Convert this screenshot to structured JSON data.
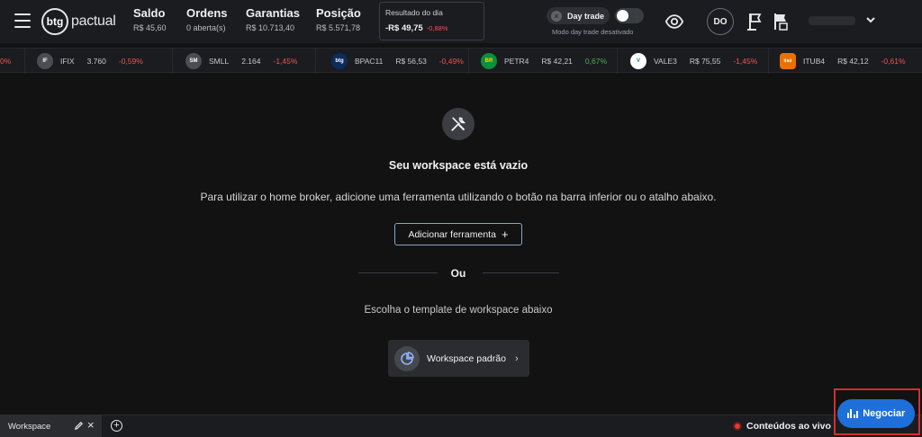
{
  "header": {
    "logo_mark": "btg",
    "logo_text": "pactual",
    "saldo": {
      "label": "Saldo",
      "value": "R$ 45,60"
    },
    "ordens": {
      "label": "Ordens",
      "value": "0 aberta(s)"
    },
    "garantias": {
      "label": "Garantias",
      "value": "R$ 10.713,40"
    },
    "posicao": {
      "label": "Posição",
      "value": "R$ 5.571,78"
    },
    "resultado": {
      "label": "Resultado do dia",
      "value": "-R$ 49,75",
      "percent": "-0,88%"
    },
    "day_trade": {
      "label": "Day trade",
      "status": "Modo day trade desativado",
      "enabled": false
    },
    "avatar_initials": "DO"
  },
  "ticker": [
    {
      "symbol": "",
      "price": "",
      "change": "0%",
      "trend": "neg",
      "icon_text": "",
      "icon_color": ""
    },
    {
      "symbol": "IFIX",
      "price": "3.760",
      "change": "-0,59%",
      "trend": "neg",
      "icon_text": "IF",
      "icon_color": "#4a4d52"
    },
    {
      "symbol": "SMLL",
      "price": "2.164",
      "change": "-1,45%",
      "trend": "neg",
      "icon_text": "SM",
      "icon_color": "#4a4d52"
    },
    {
      "symbol": "BPAC11",
      "price": "R$ 56,53",
      "change": "-0,49%",
      "trend": "neg",
      "icon_text": "btg",
      "icon_color": "#0d2a5c"
    },
    {
      "symbol": "PETR4",
      "price": "R$ 42,21",
      "change": "0,67%",
      "trend": "pos",
      "icon_text": "BR",
      "icon_color": "#0a8f3c"
    },
    {
      "symbol": "VALE3",
      "price": "R$ 75,55",
      "change": "-1,45%",
      "trend": "neg",
      "icon_text": "V",
      "icon_color": "#ffffff"
    },
    {
      "symbol": "ITUB4",
      "price": "R$ 42,12",
      "change": "-0,61%",
      "trend": "neg",
      "icon_text": "itaú",
      "icon_color": "#ec7000"
    }
  ],
  "main": {
    "title": "Seu workspace está vazio",
    "description": "Para utilizar o home broker, adicione uma ferramenta utilizando o botão na barra inferior ou o atalho abaixo.",
    "add_tool_label": "Adicionar ferramenta",
    "or_label": "Ou",
    "choose_label": "Escolha o template de workspace abaixo",
    "template_label": "Workspace padrão"
  },
  "bottom": {
    "workspace_tab": "Workspace",
    "live_label": "Conteúdos ao vivo",
    "trade_label": "Negociar"
  },
  "colors": {
    "background": "#121212",
    "header": "#1a1c20",
    "negative": "#ef5350",
    "positive": "#4caf50",
    "accent": "#1e6fd9",
    "highlight_frame": "#d32f2f"
  }
}
